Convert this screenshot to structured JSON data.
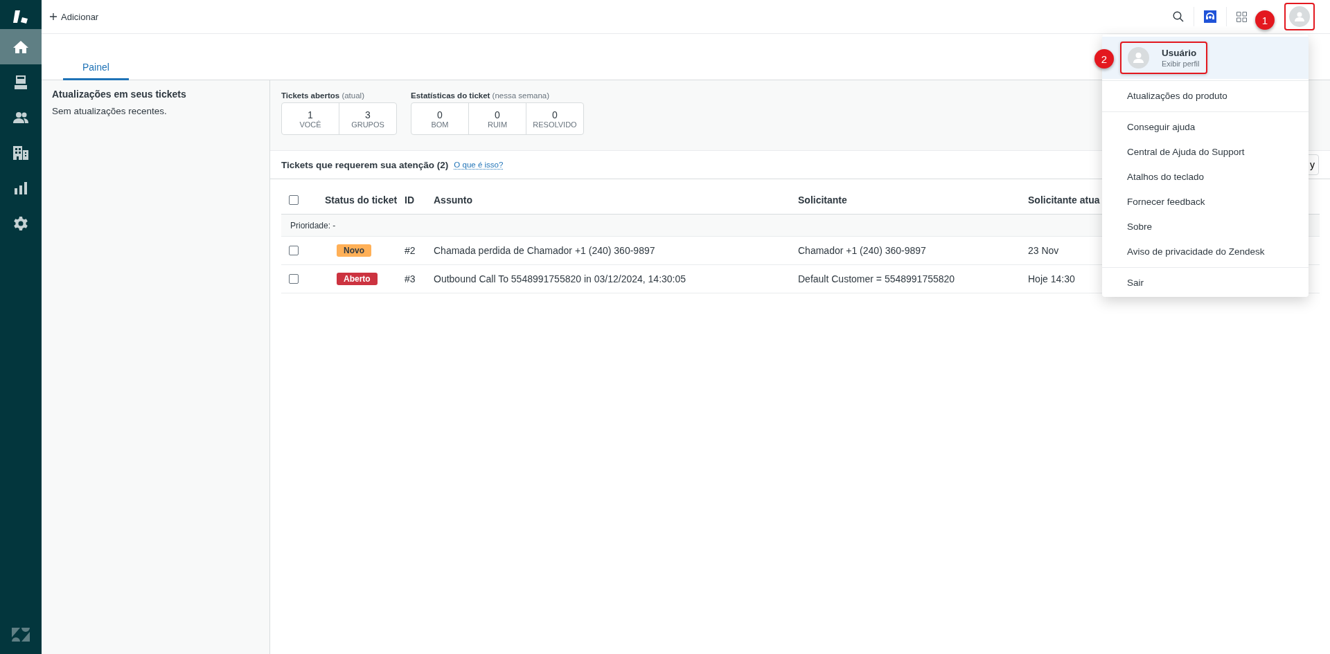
{
  "sidebar": {
    "items": [
      {
        "kind": "home",
        "selected": true
      },
      {
        "kind": "inbox",
        "selected": false
      },
      {
        "kind": "people",
        "selected": false
      },
      {
        "kind": "building",
        "selected": false
      },
      {
        "kind": "chart",
        "selected": false
      },
      {
        "kind": "gear",
        "selected": false
      }
    ]
  },
  "topbar": {
    "add_label": "Adicionar"
  },
  "tabs": [
    {
      "label": "Painel",
      "selected": true
    }
  ],
  "updates_panel": {
    "title": "Atualizações em seus tickets",
    "message": "Sem atualizações recentes."
  },
  "stats": [
    {
      "title": "Tickets abertos",
      "note": "(atual)",
      "cells": [
        {
          "value": "1",
          "label": "VOCÊ"
        },
        {
          "value": "3",
          "label": "GRUPOS"
        }
      ]
    },
    {
      "title": "Estatísticas do ticket",
      "note": "(nessa semana)",
      "cells": [
        {
          "value": "0",
          "label": "BOM"
        },
        {
          "value": "0",
          "label": "RUIM"
        },
        {
          "value": "0",
          "label": "RESOLVIDO"
        }
      ]
    }
  ],
  "attention": {
    "title": "Tickets que requerem sua atenção (2)",
    "link": "O que é isso?",
    "button": "y"
  },
  "table": {
    "select_all_checked": false,
    "columns": [
      "Status do ticket",
      "ID",
      "Assunto",
      "Solicitante",
      "Solicitante atua"
    ],
    "group": "Prioridade: -",
    "rows": [
      {
        "checked": false,
        "status": "Novo",
        "color": "#ffb057",
        "id": "#2",
        "subject": "Chamada perdida de Chamador +1 (240) 360-9897",
        "requester": "Chamador +1 (240) 360-9897",
        "updated": "23 Nov"
      },
      {
        "checked": false,
        "status": "Aberto",
        "color": "#cc3340",
        "id": "#3",
        "subject": "Outbound Call To 5548991755820 in 03/12/2024, 14:30:05",
        "requester": "Default Customer = 5548991755820",
        "updated": "Hoje 14:30"
      }
    ]
  },
  "user_menu": {
    "name": "Usuário",
    "subtitle": "Exibir perfil",
    "sections": [
      [
        "Atualizações do produto"
      ],
      [
        "Conseguir ajuda",
        "Central de Ajuda do Support",
        "Atalhos do teclado",
        "Fornecer feedback",
        "Sobre",
        "Aviso de privacidade do Zendesk"
      ],
      [
        "Sair"
      ]
    ]
  },
  "annotations": [
    {
      "label": "1"
    },
    {
      "label": "2"
    }
  ]
}
